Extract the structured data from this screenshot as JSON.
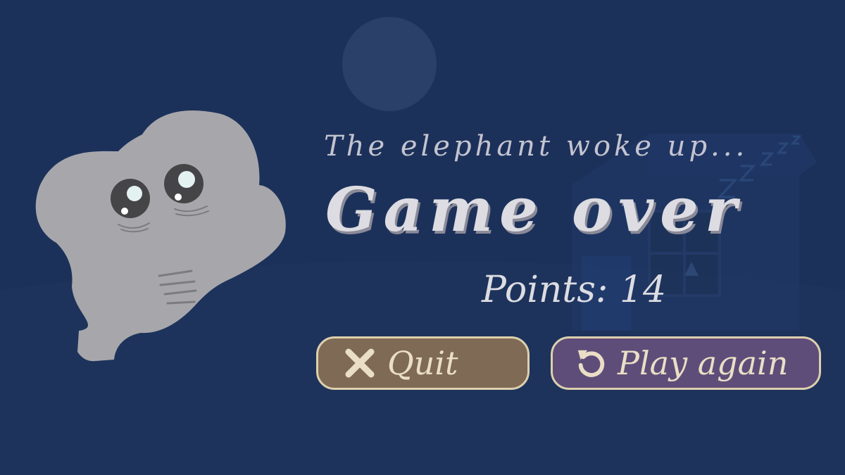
{
  "scene": {
    "subtitle": "The elephant woke up...",
    "title": "Game over",
    "score_text": "Points: 14",
    "moon_icon": "moon",
    "background_house_icon": "house-with-snoring-zzz",
    "character_icon": "elephant-head"
  },
  "buttons": {
    "quit": {
      "label": "Quit",
      "icon": "close-x-icon",
      "color": "#7f6a55"
    },
    "play_again": {
      "label": "Play again",
      "icon": "restart-arrow-icon",
      "color": "#5f4d79"
    }
  },
  "colors": {
    "background": "#1c315a",
    "text": "#dcdce2",
    "button_border": "#ddd0ad",
    "button_text": "#eadfc6",
    "elephant": "#a7a7ab"
  }
}
